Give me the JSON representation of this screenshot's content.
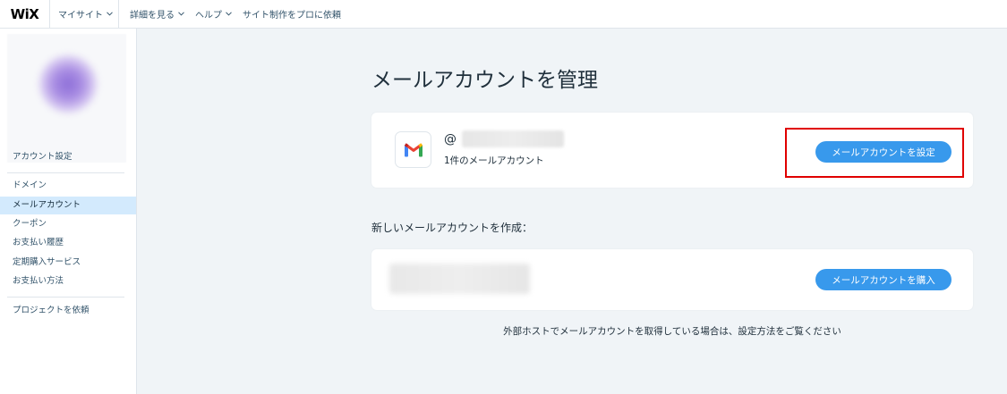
{
  "topbar": {
    "logo": "WiX",
    "my_sites": "マイサイト",
    "nav": [
      "詳細を見る",
      "ヘルプ",
      "サイト制作をプロに依頼"
    ]
  },
  "sidebar": {
    "items": [
      {
        "label": "アカウント設定",
        "active": false
      },
      {
        "label": "ドメイン",
        "active": false
      },
      {
        "label": "メールアカウント",
        "active": true
      },
      {
        "label": "クーポン",
        "active": false
      },
      {
        "label": "お支払い履歴",
        "active": false
      },
      {
        "label": "定期購入サービス",
        "active": false
      },
      {
        "label": "お支払い方法",
        "active": false
      },
      {
        "label": "プロジェクトを依頼",
        "active": false
      }
    ]
  },
  "main": {
    "title": "メールアカウントを管理",
    "account_card": {
      "email_prefix": "@",
      "account_count": "1件のメールアカウント",
      "setup_button": "メールアカウントを設定"
    },
    "create_section_label": "新しいメールアカウントを作成：",
    "create_card": {
      "buy_button": "メールアカウントを購入"
    },
    "footnote": "外部ホストでメールアカウントを取得している場合は、設定方法をご覧ください"
  },
  "colors": {
    "accent": "#3899ec",
    "active_nav": "#d3eafd",
    "highlight": "#e00000",
    "page_bg": "#f0f4f7"
  },
  "icons": [
    "wix-logo",
    "chevron-down-icon",
    "gmail-icon"
  ]
}
